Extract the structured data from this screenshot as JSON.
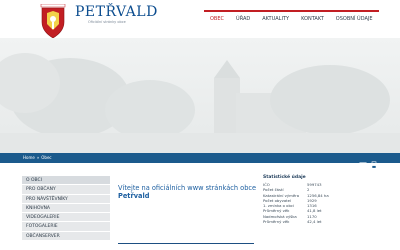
{
  "brand": {
    "title": "PETŘVALD",
    "subtitle": "Oficiální stránky obce",
    "crest_text": "PETŘVALD"
  },
  "nav": {
    "items": [
      {
        "label": "OBEC",
        "active": true
      },
      {
        "label": "ÚŘAD",
        "active": false
      },
      {
        "label": "AKTUALITY",
        "active": false
      },
      {
        "label": "KONTAKT",
        "active": false
      },
      {
        "label": "OSOBNÍ ÚDAJE",
        "active": false
      }
    ]
  },
  "breadcrumb": {
    "home": "Home",
    "separator": "»",
    "current": "Obec"
  },
  "toolbar": {
    "icons": [
      "mail-icon",
      "print-icon"
    ]
  },
  "sidebar": {
    "items": [
      {
        "label": "O OBCI"
      },
      {
        "label": "PRO OBČANY"
      },
      {
        "label": "PRO NÁVŠTĚVNÍKY"
      },
      {
        "label": "KNIHOVNA"
      },
      {
        "label": "VIDEOGALERIE"
      },
      {
        "label": "FOTOGALERIE"
      },
      {
        "label": "OBČANSERVER"
      }
    ]
  },
  "welcome": {
    "line1": "Vítejte na oficiálních www stránkách obce",
    "line2": "Petřvald"
  },
  "stats": {
    "title": "Statistické údaje",
    "rows": [
      {
        "label": "IČO",
        "value": "599743"
      },
      {
        "label": "Počet částí",
        "value": "2"
      },
      {
        "label": "Katastrální výměra",
        "value": "1256,84 ha"
      },
      {
        "label": "Počet obyvatel",
        "value": "1929"
      },
      {
        "label": "1. zmínka o obci",
        "value": "1316"
      },
      {
        "label": "Průměrný věk",
        "value": "41,8 let"
      },
      {
        "label": "Nadmořská výška",
        "value": "1170"
      },
      {
        "label": "Průměrný věk",
        "value": "42,4 let"
      }
    ]
  },
  "colors": {
    "brand_blue": "#0c4d8f",
    "accent_red": "#c21e23",
    "breadcrumb_bar": "#1b5a8c",
    "link_blue": "#1d5fa0"
  }
}
